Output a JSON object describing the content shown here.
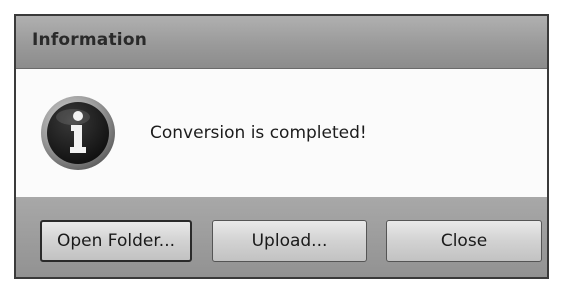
{
  "dialog": {
    "title": "Information",
    "message": "Conversion is completed!",
    "icon": "info-icon"
  },
  "buttons": {
    "open_folder": "Open Folder...",
    "upload": "Upload...",
    "close": "Close"
  }
}
